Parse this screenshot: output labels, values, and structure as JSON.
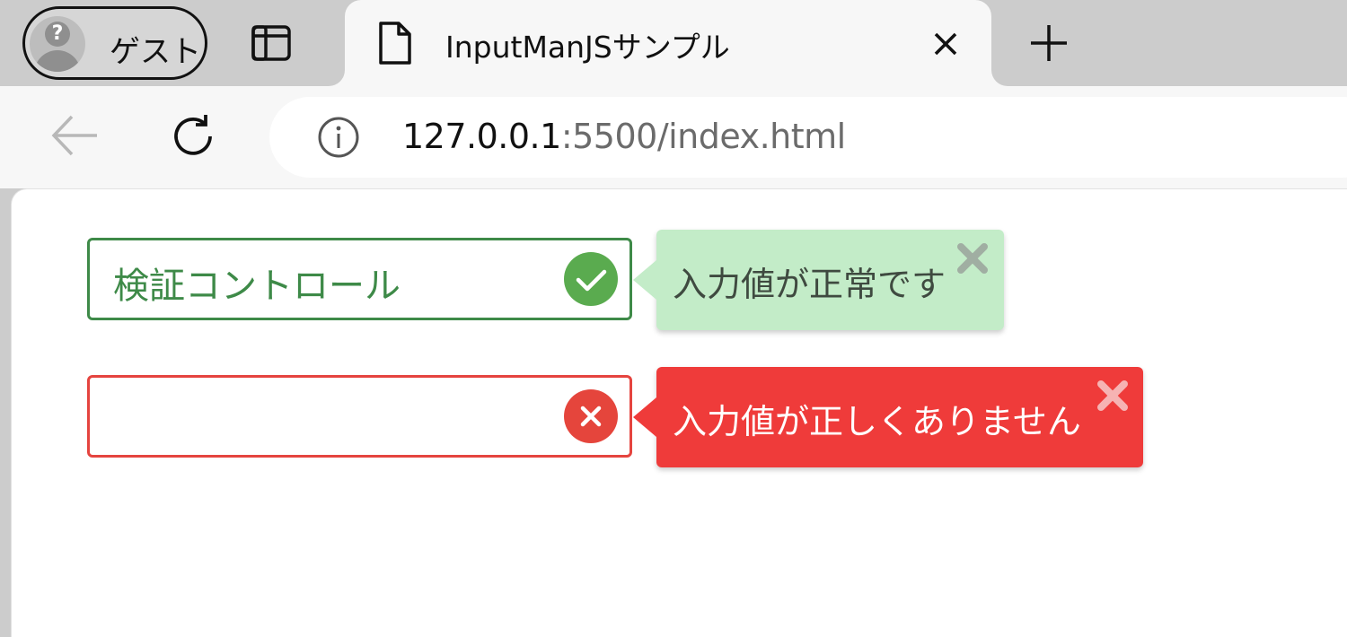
{
  "browser": {
    "profile": {
      "label": "ゲスト",
      "icon": "guest-avatar-icon"
    },
    "tabs": [
      {
        "title": "InputManJSサンプル",
        "icon": "document-icon",
        "active": true
      }
    ],
    "address_bar": {
      "url_host": "127.0.0.1",
      "url_rest": ":5500/index.html",
      "icon": "info-icon"
    }
  },
  "page": {
    "fields": [
      {
        "value": "検証コントロール",
        "state": "valid",
        "status_icon": "check-circle-icon",
        "tooltip": "入力値が正常です"
      },
      {
        "value": "",
        "state": "invalid",
        "status_icon": "error-circle-icon",
        "tooltip": "入力値が正しくありません"
      }
    ]
  },
  "colors": {
    "valid_border": "#3e8a48",
    "valid_icon": "#5aab4f",
    "valid_tooltip_bg": "#c3ecc8",
    "invalid_border": "#e5443f",
    "invalid_icon": "#e5453c",
    "invalid_tooltip_bg": "#ef3b3a"
  }
}
